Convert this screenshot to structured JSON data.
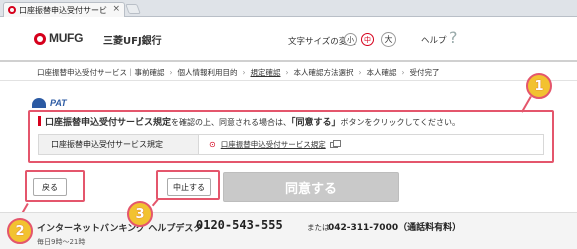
{
  "browser": {
    "tab_title": "口座振替申込受付サービ",
    "tab_close": "×"
  },
  "header": {
    "logo_text": "MUFG",
    "bank_name": "三菱UFJ銀行",
    "fontsize_label": "文字サイズの変更",
    "fontsize_small": "小",
    "fontsize_medium": "中",
    "fontsize_large": "大",
    "help": "ヘルプ",
    "help_icon": "?"
  },
  "breadcrumb": {
    "items": [
      "口座振替申込受付サービス｜事前確認",
      "個人情報利用目的",
      "規定確認",
      "本人確認方法選択",
      "本人確認",
      "受付完了"
    ],
    "separator": "›",
    "active_index": 2
  },
  "jpat": {
    "label": "PAT"
  },
  "confirm": {
    "notice_bold": "口座振替申込受付サービス規定",
    "notice_mid": "を確認の上、同意される場合は、",
    "notice_quote": "「同意する」",
    "notice_tail": "ボタンをクリックしてください。",
    "rule_label": "口座振替申込受付サービス規定",
    "rule_dot": "⊙",
    "rule_link": "口座振替申込受付サービス規定"
  },
  "buttons": {
    "back": "戻る",
    "stop": "中止する",
    "agree": "同意する"
  },
  "callouts": {
    "one": "1",
    "two": "2",
    "three": "3"
  },
  "footer": {
    "helpdesk": "インターネットバンキング ヘルプデスク",
    "phone": "0120-543-555",
    "or": "または",
    "phone2": "042-311-7000（通話料有料）",
    "hours": "毎日9時～21時"
  },
  "colors": {
    "brand_red": "#d6001c",
    "callout_border": "#e4566c",
    "callout_badge": "#f2c230",
    "disabled_button": "#c9c9c9"
  }
}
